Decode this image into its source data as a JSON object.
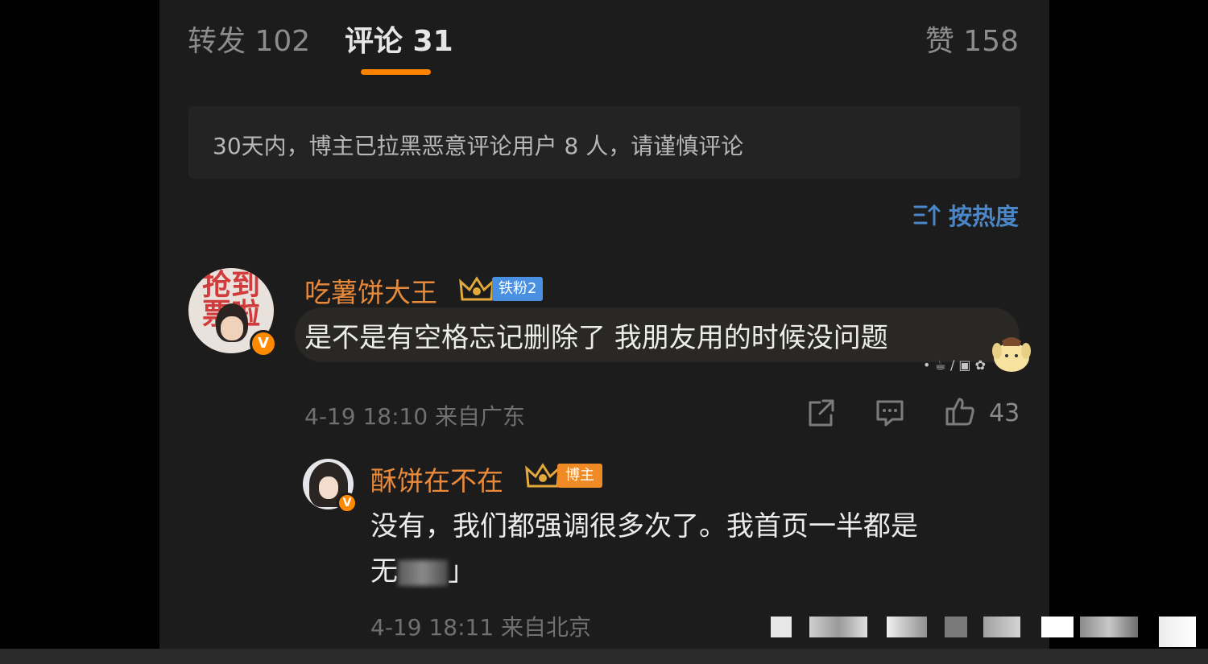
{
  "tabs": {
    "repost_label": "转发 102",
    "comments_label": "评论 31",
    "likes_label": "赞 158"
  },
  "notice": {
    "text": "30天内，博主已拉黑恶意评论用户 8 人，请谨慎评论"
  },
  "sort": {
    "label": "按热度",
    "icon": "sort-icon"
  },
  "comment": {
    "username": "吃薯饼大王",
    "avatar_text": "抢到\n票啦",
    "verified_badge": "V",
    "fan_badge": "铁粉2",
    "text": "是不是有空格忘记删除了 我朋友用的时候没问题",
    "sticker_dots": "• ☕ / ▣ ✿",
    "meta": "4-19 18:10 来自广东",
    "like_count": "43"
  },
  "reply": {
    "username": "酥饼在不在",
    "verified_badge": "V",
    "blogger_badge": "博主",
    "text_main": "没有，我们都强调很多次了。我首页一半都是",
    "text_line2": "无",
    "text_tail": "」",
    "meta": "4-19 18:11 来自北京"
  },
  "colors": {
    "accent": "#ff8200",
    "username": "#e88a3a",
    "link": "#4a86c8",
    "fan_badge": "#4a90e2",
    "blogger_badge": "#f08a24"
  }
}
